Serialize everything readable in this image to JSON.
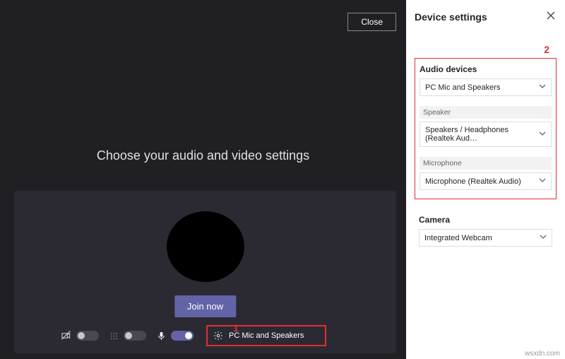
{
  "close_label": "Close",
  "prompt": "Choose your audio and video settings",
  "join_label": "Join now",
  "device_select": {
    "label": "PC Mic and Speakers"
  },
  "annotations": {
    "one": "1",
    "two": "2"
  },
  "panel": {
    "title": "Device settings",
    "audio_devices_label": "Audio devices",
    "audio_devices_value": "PC Mic and Speakers",
    "speaker_label": "Speaker",
    "speaker_value": "Speakers / Headphones (Realtek Aud…",
    "microphone_label": "Microphone",
    "microphone_value": "Microphone (Realtek Audio)",
    "camera_label": "Camera",
    "camera_value": "Integrated Webcam"
  },
  "watermark": "wsxdn.com"
}
